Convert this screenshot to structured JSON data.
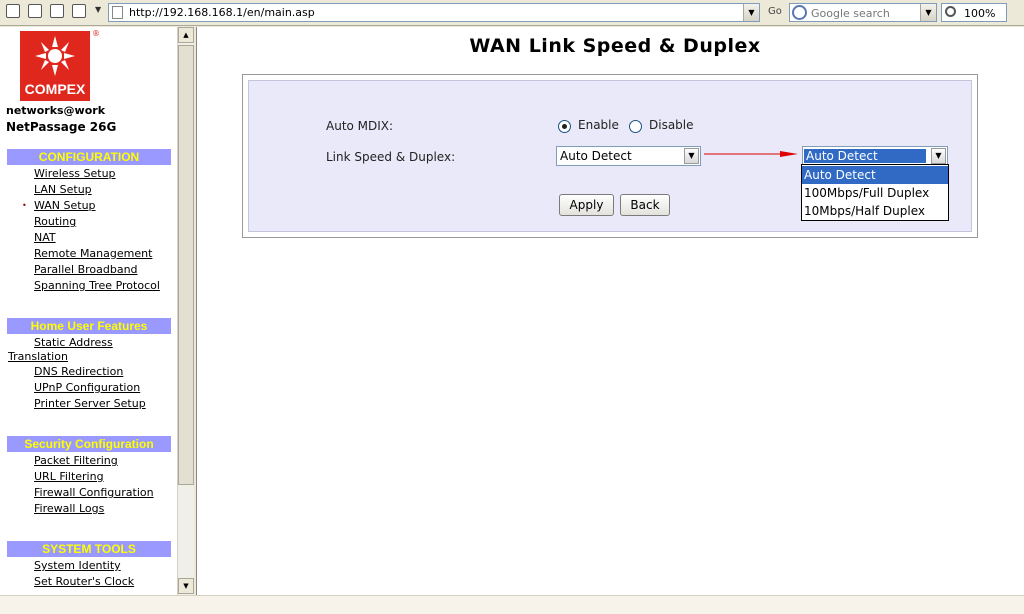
{
  "browser": {
    "address_url": "http://192.168.168.1/en/main.asp",
    "go_label": "Go",
    "search_placeholder": "Google search",
    "zoom": "100%"
  },
  "sidebar": {
    "logo_text": "COMPEX",
    "logo_registered": "®",
    "tagline": "networks@work",
    "model": "NetPassage 26G",
    "sections": {
      "configuration": {
        "title": "CONFIGURATION",
        "items": [
          "Wireless Setup",
          "LAN Setup",
          "WAN Setup",
          "Routing",
          "NAT",
          "Remote Management",
          "Parallel Broadband",
          "Spanning Tree Protocol"
        ]
      },
      "home": {
        "title": "Home User Features",
        "items": [
          "Static Address Translation",
          "DNS Redirection",
          "UPnP Configuration",
          "Printer Server Setup"
        ]
      },
      "security": {
        "title": "Security Configuration",
        "items": [
          "Packet Filtering",
          "URL Filtering",
          "Firewall Configuration",
          "Firewall Logs"
        ]
      },
      "tools": {
        "title": "SYSTEM TOOLS",
        "items": [
          "System Identity",
          "Set Router's Clock"
        ]
      }
    },
    "active_item": "WAN Setup"
  },
  "main": {
    "title": "WAN Link Speed & Duplex",
    "mdix_label": "Auto MDIX:",
    "enable_label": "Enable",
    "disable_label": "Disable",
    "mdix_selected": "Enable",
    "link_label": "Link Speed & Duplex:",
    "link_select_value": "Auto Detect",
    "apply_label": "Apply",
    "back_label": "Back",
    "dropdown": {
      "value": "Auto Detect",
      "options": [
        "Auto Detect",
        "100Mbps/Full Duplex",
        "10Mbps/Half Duplex"
      ],
      "highlighted": "Auto Detect"
    },
    "arrow_color": "#e00000"
  },
  "colors": {
    "section_bg": "#9999ff",
    "section_fg": "#ffff00",
    "logo_red": "#e0271e",
    "panel_bg": "#e9e9f9",
    "highlight": "#316ac5"
  }
}
